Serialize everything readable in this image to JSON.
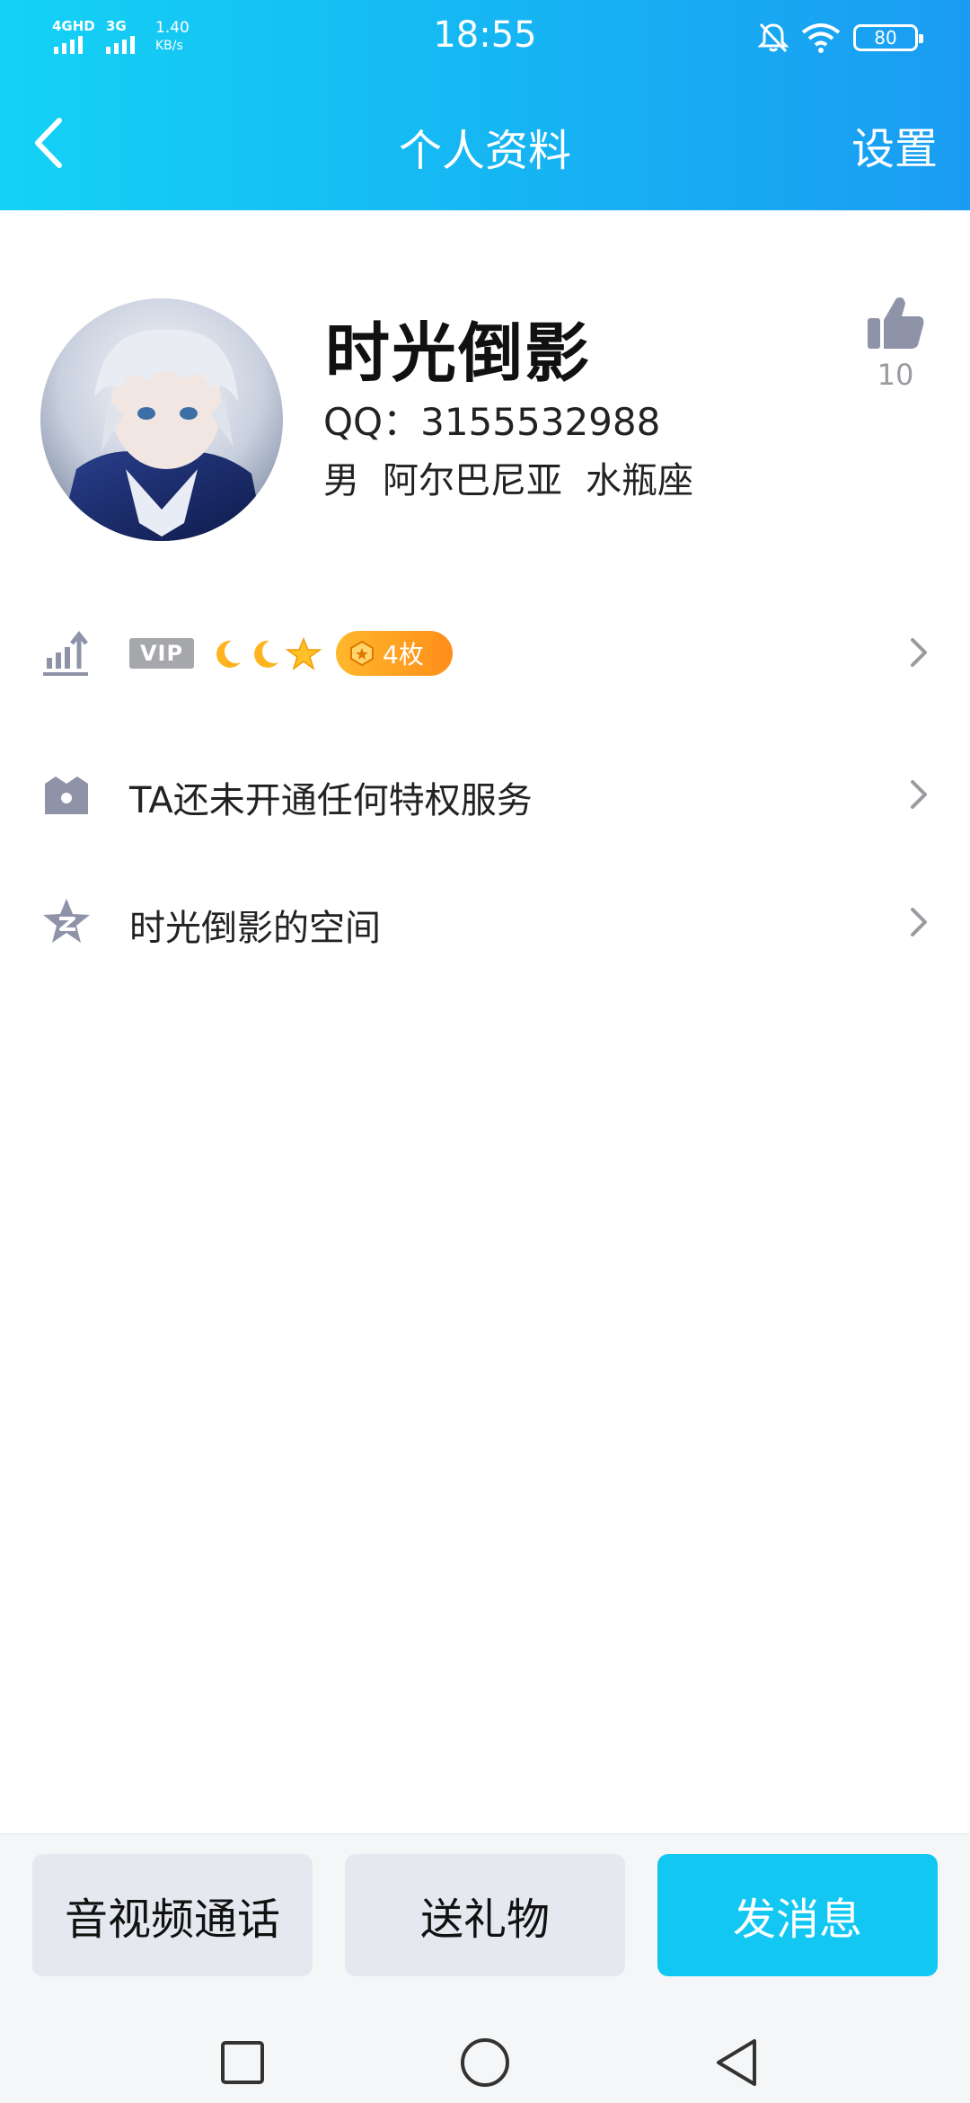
{
  "status_bar": {
    "network1": "4GHD",
    "network2": "3G",
    "speed_value": "1.40",
    "speed_unit": "KB/s",
    "time": "18:55",
    "battery": "80"
  },
  "nav": {
    "title": "个人资料",
    "settings_label": "设置"
  },
  "profile": {
    "nickname": "时光倒影",
    "qq_line": "QQ：3155532988",
    "gender": "男",
    "region": "阿尔巴尼亚",
    "zodiac": "水瓶座",
    "like_count": "10"
  },
  "rows": {
    "vip": {
      "badge": "VIP",
      "medal_count": "4枚"
    },
    "privilege_text": "TA还未开通任何特权服务",
    "space_text": "时光倒影的空间"
  },
  "actions": {
    "call_label": "音视频通话",
    "gift_label": "送礼物",
    "message_label": "发消息"
  },
  "colors": {
    "header_gradient_start": "#14d2f5",
    "header_gradient_end": "#1a9cf2",
    "primary": "#12c8f2",
    "medal": "#ff9a1f",
    "icon_grey": "#8e93a8"
  }
}
